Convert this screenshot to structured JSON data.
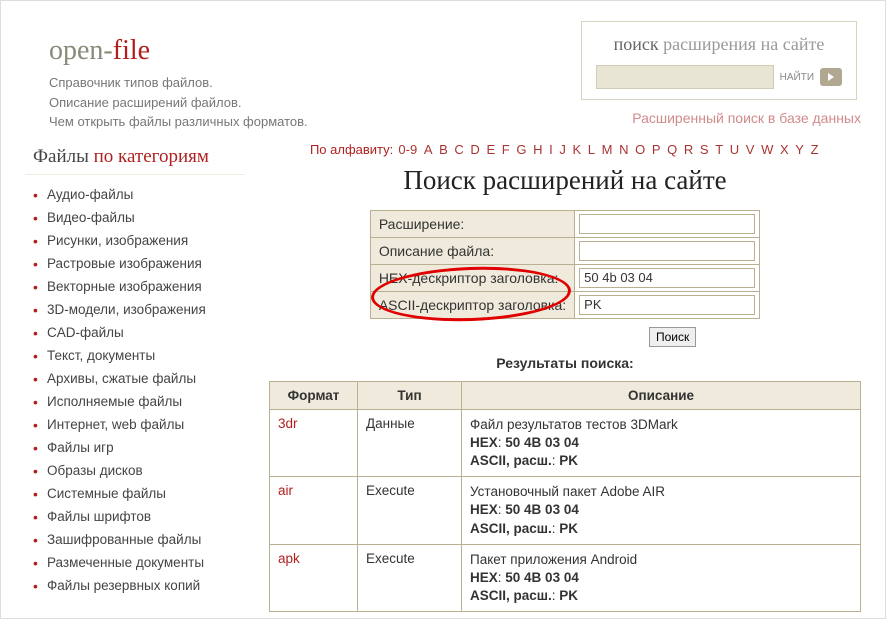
{
  "brand": {
    "t1": "open-",
    "t2": "file",
    "sub1": "Справочник типов файлов.",
    "sub2": "Описание расширений файлов.",
    "sub3": "Чем открыть файлы различных форматов."
  },
  "searchbox": {
    "t1": "поиск",
    "t2": " расширения на сайте",
    "placeholder": "",
    "find": "НАЙТИ",
    "adv": "Расширенный поиск в базе данных"
  },
  "sidebar": {
    "t1": "Файлы ",
    "t2": "по категориям",
    "items": [
      "Аудио-файлы",
      "Видео-файлы",
      "Рисунки, изображения",
      "Растровые изображения",
      "Векторные изображения",
      "3D-модели, изображения",
      "CAD-файлы",
      "Текст, документы",
      "Архивы, сжатые файлы",
      "Исполняемые файлы",
      "Интернет, web файлы",
      "Файлы игр",
      "Образы дисков",
      "Системные файлы",
      "Файлы шрифтов",
      "Зашифрованные файлы",
      "Размеченные документы",
      "Файлы резервных копий"
    ]
  },
  "alpha": {
    "label": "По алфавиту:",
    "letters": [
      "0-9",
      "A",
      "B",
      "C",
      "D",
      "E",
      "F",
      "G",
      "H",
      "I",
      "J",
      "K",
      "L",
      "M",
      "N",
      "O",
      "P",
      "Q",
      "R",
      "S",
      "T",
      "U",
      "V",
      "W",
      "X",
      "Y",
      "Z"
    ]
  },
  "heading": "Поиск расширений на сайте",
  "form": {
    "row1": "Расширение:",
    "row2": "Описание файла:",
    "row3": "HEX-дескриптор заголовка:",
    "row4": "ASCII-дескриптор заголовка:",
    "val1": "",
    "val2": "",
    "val3": "50 4b 03 04",
    "val4": "PK",
    "submit": "Поиск"
  },
  "results": {
    "title": "Результаты поиска:",
    "th1": "Формат",
    "th2": "Тип",
    "th3": "Описание",
    "rows": [
      {
        "fmt": "3dr",
        "type": "Данные",
        "desc": "Файл результатов тестов 3DMark",
        "hex": "50 4B 03 04",
        "ascii": "PK"
      },
      {
        "fmt": "air",
        "type": "Execute",
        "desc": "Установочный пакет Adobe AIR",
        "hex": "50 4B 03 04",
        "ascii": "PK"
      },
      {
        "fmt": "apk",
        "type": "Execute",
        "desc": "Пакет приложения Android",
        "hex": "50 4B 03 04",
        "ascii": "PK"
      }
    ],
    "hexlabel": "HEX",
    "asciilabel": "ASCII, расш.",
    "sep": ": "
  }
}
